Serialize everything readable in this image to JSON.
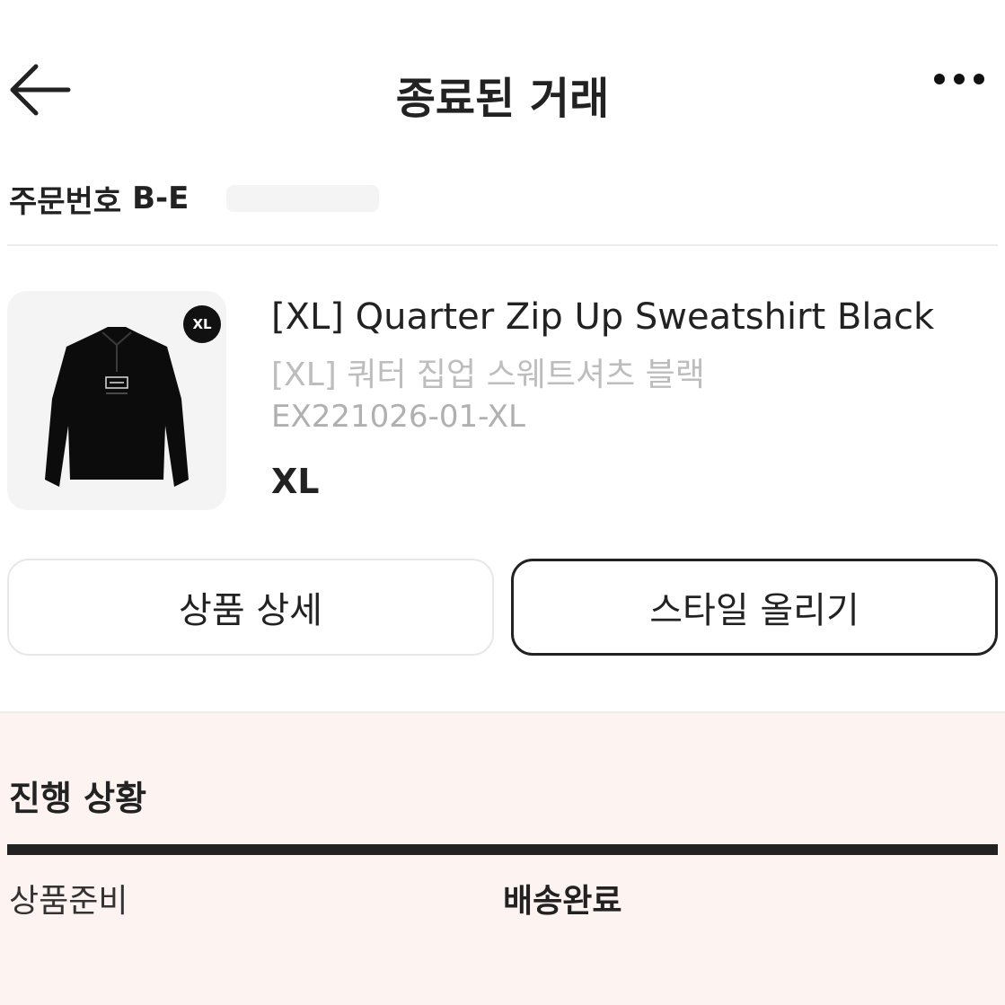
{
  "header": {
    "title": "종료된 거래",
    "back_icon": "arrow-left-icon",
    "more_icon": "more-horizontal-icon"
  },
  "order": {
    "label": "주문번호",
    "number": "B-E"
  },
  "product": {
    "size_badge": "XL",
    "name_en": "[XL] Quarter Zip Up Sweatshirt Black",
    "name_ko": "[XL] 쿼터 집업 스웨트셔츠 블랙",
    "code": "EX221026-01-XL",
    "size": "XL"
  },
  "buttons": {
    "detail": "상품 상세",
    "style": "스타일 올리기"
  },
  "progress": {
    "title": "진행 상황",
    "steps": [
      "상품준비",
      "배송완료"
    ],
    "fraction_complete": 1.0
  },
  "colors": {
    "accent": "#222222",
    "muted_text": "#bdbdbd",
    "progress_bg": "#fdf4f2"
  }
}
